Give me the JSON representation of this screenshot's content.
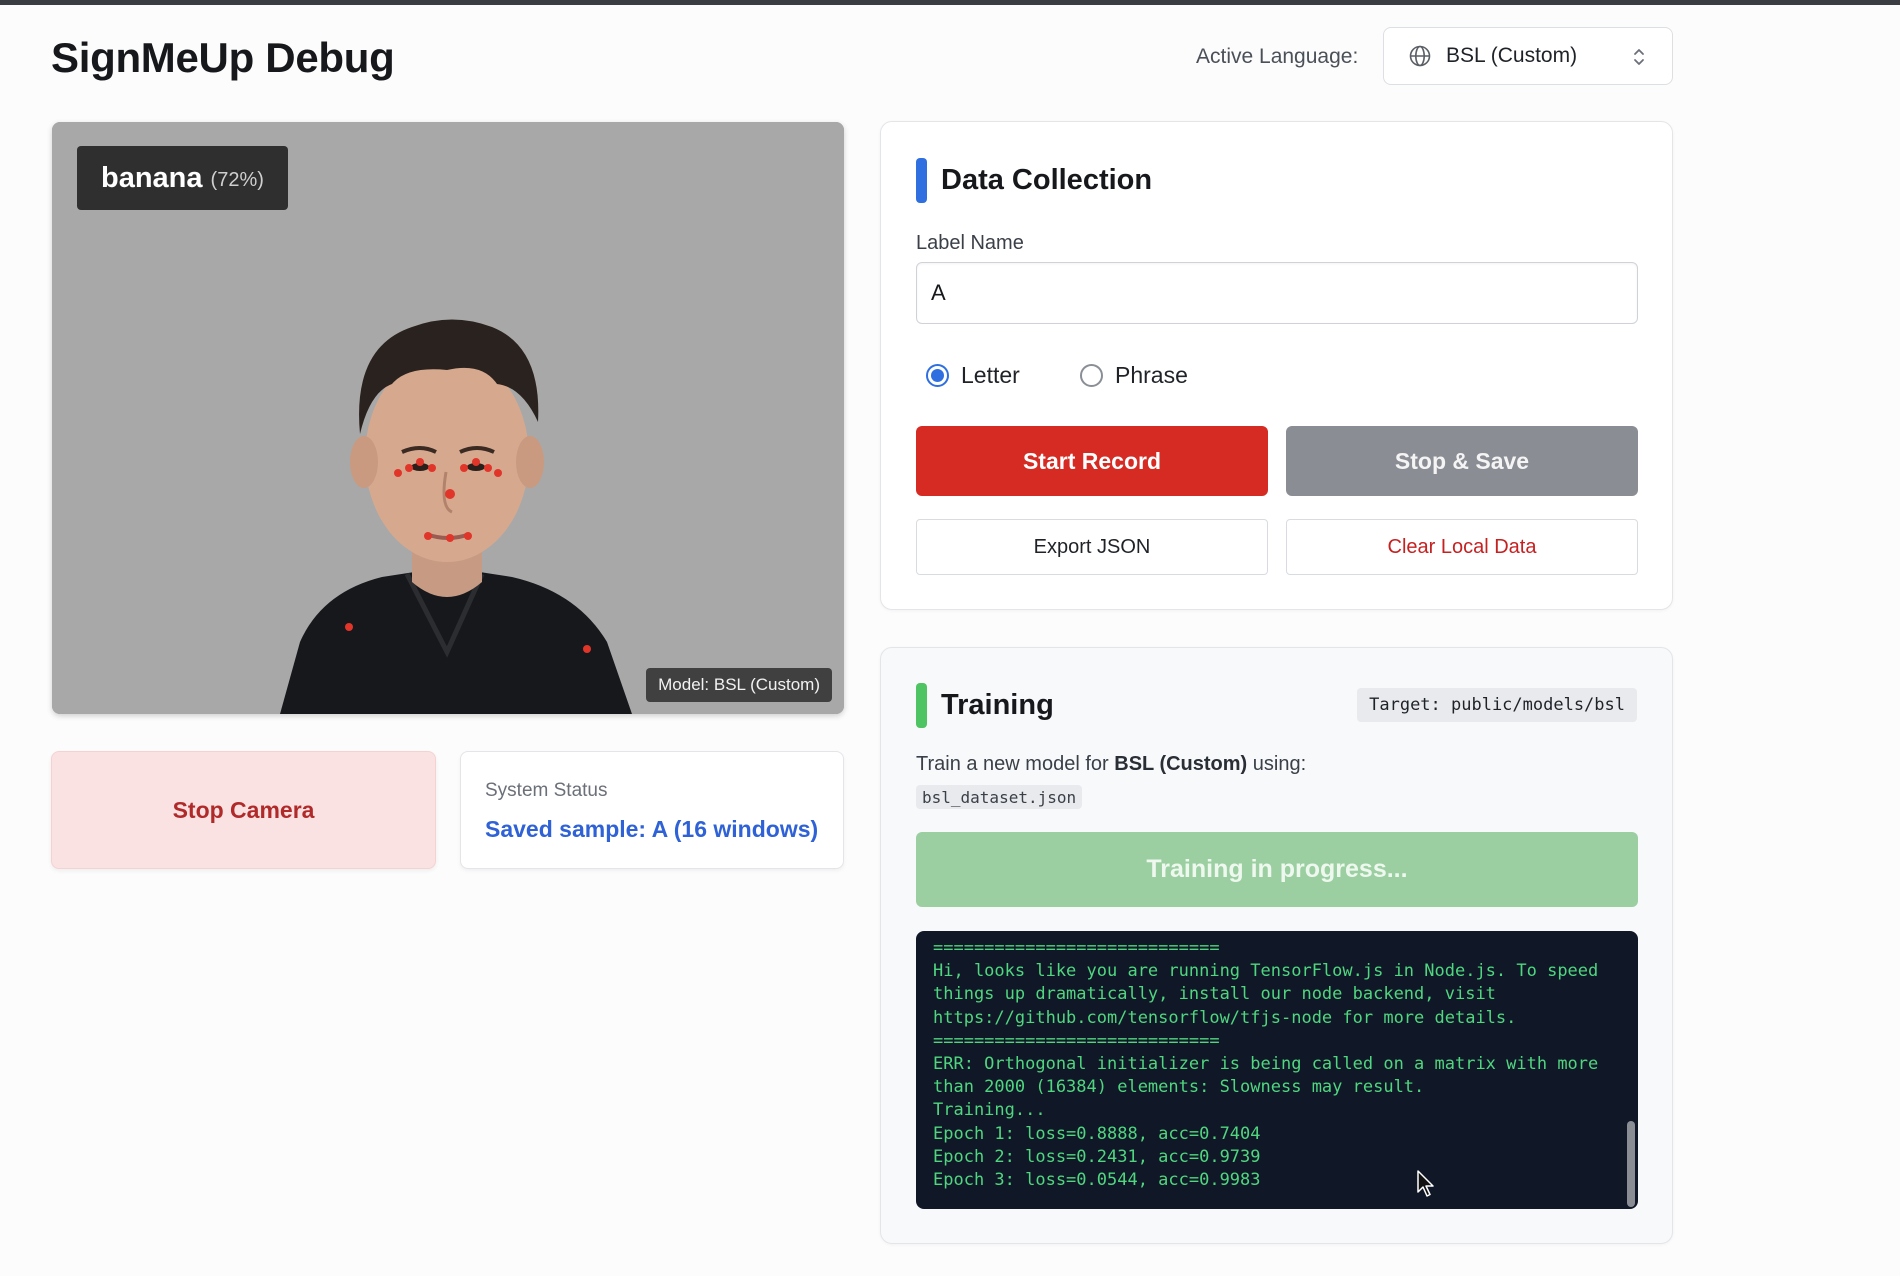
{
  "header": {
    "title": "SignMeUp Debug",
    "language_label": "Active Language:",
    "language_value": "BSL (Custom)"
  },
  "camera": {
    "prediction_word": "banana",
    "prediction_confidence": "(72%)",
    "model_tag": "Model: BSL (Custom)",
    "stop_button": "Stop Camera"
  },
  "status": {
    "label": "System Status",
    "value": "Saved sample: A (16 windows)"
  },
  "data_collection": {
    "title": "Data Collection",
    "accent_color": "#2f6fe0",
    "label_name_label": "Label Name",
    "label_name_value": "A",
    "radio_options": [
      {
        "label": "Letter",
        "selected": true
      },
      {
        "label": "Phrase",
        "selected": false
      }
    ],
    "start_record": "Start Record",
    "stop_save": "Stop & Save",
    "export_json": "Export JSON",
    "clear_local": "Clear Local Data"
  },
  "training": {
    "title": "Training",
    "accent_color": "#4fc462",
    "target": "Target: public/models/bsl",
    "desc_prefix": "Train a new model for",
    "desc_language": "BSL (Custom)",
    "desc_suffix": "using:",
    "dataset": "bsl_dataset.json",
    "progress_button": "Training in progress...",
    "console_lines": [
      "============================",
      "Hi, looks like you are running TensorFlow.js in Node.js. To speed",
      "things up dramatically, install our node backend, visit",
      "https://github.com/tensorflow/tfjs-node for more details.",
      "============================",
      "ERR: Orthogonal initializer is being called on a matrix with more",
      "than 2000 (16384) elements: Slowness may result.",
      "Training...",
      "Epoch 1: loss=0.8888, acc=0.7404",
      "Epoch 2: loss=0.2431, acc=0.9739",
      "Epoch 3: loss=0.0544, acc=0.9983"
    ]
  },
  "colors": {
    "danger": "#d62b23",
    "status_blue": "#2f62d6",
    "console_bg": "#101828",
    "console_text": "#4fd67e"
  }
}
